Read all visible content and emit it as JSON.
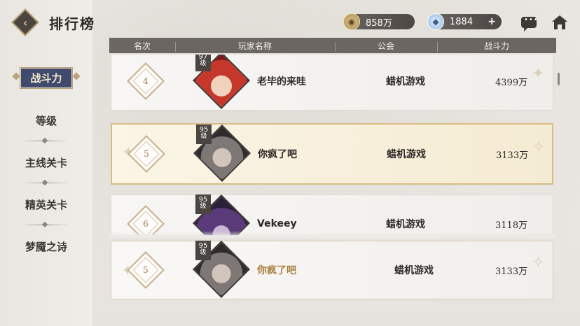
{
  "header": {
    "title": "排行榜",
    "gold_value": "858万",
    "gem_value": "1884",
    "gem_add": "+"
  },
  "icons": {
    "back": "back-icon",
    "gold": "gold-coin-icon",
    "gem": "diamond-gem-icon",
    "chat": "chat-bubble-icon",
    "home": "home-icon"
  },
  "sidebar": {
    "items": [
      {
        "label": "战斗力",
        "active": true
      },
      {
        "label": "等级",
        "active": false
      },
      {
        "label": "主线关卡",
        "active": false
      },
      {
        "label": "精英关卡",
        "active": false
      },
      {
        "label": "梦魇之诗",
        "active": false
      }
    ]
  },
  "table": {
    "columns": [
      "名次",
      "玩家名称",
      "公会",
      "战斗力"
    ],
    "rows": [
      {
        "rank": "4",
        "level": "97",
        "level_unit": "级",
        "name": "老毕的来哇",
        "guild": "蜡机游戏",
        "power": "4399万",
        "avatar": "red-hair-avatar",
        "highlight": false
      },
      {
        "rank": "5",
        "level": "95",
        "level_unit": "级",
        "name": "你疯了吧",
        "guild": "蜡机游戏",
        "power": "3133万",
        "avatar": "grey-hair-avatar",
        "highlight": true
      },
      {
        "rank": "6",
        "level": "95",
        "level_unit": "级",
        "name": "Vekeey",
        "guild": "蜡机游戏",
        "power": "3118万",
        "avatar": "purple-hair-avatar",
        "highlight": false
      }
    ]
  },
  "my_rank": {
    "rank": "5",
    "level": "95",
    "level_unit": "级",
    "name": "你疯了吧",
    "guild": "蜡机游戏",
    "power": "3133万",
    "avatar": "grey-hair-avatar"
  },
  "colors": {
    "accent_gold": "#c9b089",
    "header_bar": "#6b6661",
    "active_tab": "#3f4a6e",
    "my_name": "#a77f3c"
  }
}
